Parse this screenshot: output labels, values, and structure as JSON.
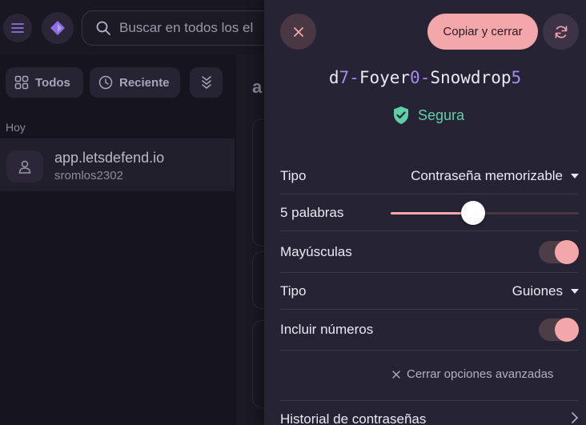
{
  "search": {
    "placeholder": "Buscar en todos los el"
  },
  "filters": {
    "all": "Todos",
    "recent": "Reciente"
  },
  "list": {
    "section": "Hoy",
    "items": [
      {
        "title": "app.letsdefend.io",
        "subtitle": "sromlos2302"
      }
    ]
  },
  "right_pane": {
    "letter": "a"
  },
  "generator": {
    "copy_label": "Copiar y cerrar",
    "password_parts": [
      {
        "text": "d",
        "kind": "char"
      },
      {
        "text": "7",
        "kind": "num"
      },
      {
        "text": "-",
        "kind": "sep"
      },
      {
        "text": "Foyer",
        "kind": "char"
      },
      {
        "text": "0",
        "kind": "num"
      },
      {
        "text": "-",
        "kind": "sep"
      },
      {
        "text": "Snowdrop",
        "kind": "char"
      },
      {
        "text": "5",
        "kind": "num"
      }
    ],
    "strength": "Segura",
    "type_label": "Tipo",
    "type_value": "Contraseña memorizable",
    "words_label": "5 palabras",
    "words_slider_fraction": 0.44,
    "caps_label": "Mayúsculas",
    "caps_on": true,
    "separator_label": "Tipo",
    "separator_value": "Guiones",
    "numbers_label": "Incluir números",
    "numbers_on": true,
    "close_advanced": "Cerrar opciones avanzadas",
    "history": "Historial de contraseñas"
  },
  "colors": {
    "accent": "#f4a7aa",
    "secure": "#5fcfa8",
    "highlight": "#a888f2"
  }
}
